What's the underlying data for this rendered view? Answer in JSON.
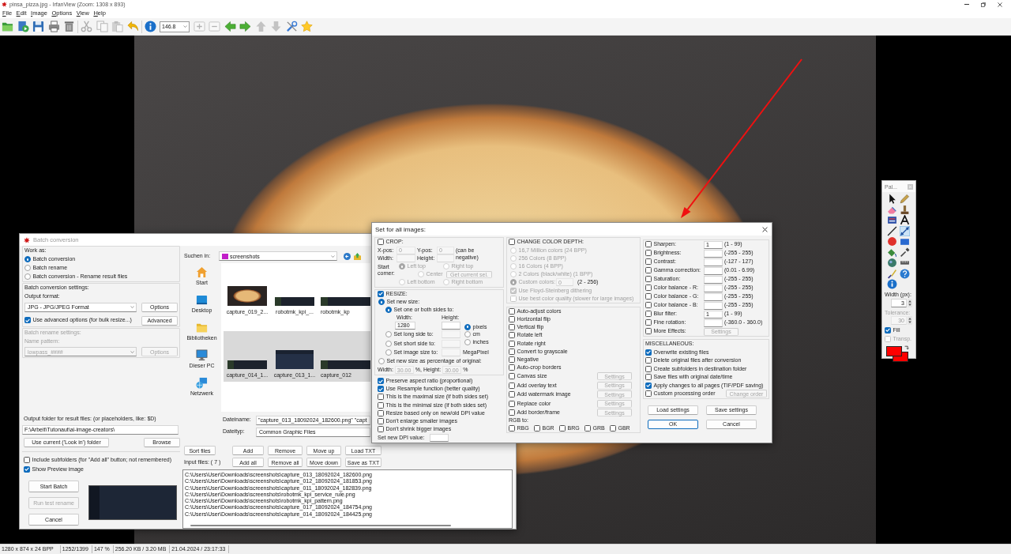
{
  "window": {
    "title": "pinsa_pizza.jpg - IrfanView (Zoom: 1308 x 893)"
  },
  "menu": [
    "File",
    "Edit",
    "Image",
    "Options",
    "View",
    "Help"
  ],
  "toolbar": {
    "groups": [
      [
        {
          "kind": "open",
          "disabled": false
        },
        {
          "kind": "slideshow",
          "disabled": false
        },
        {
          "kind": "save",
          "disabled": false
        },
        {
          "kind": "print",
          "disabled": false
        },
        {
          "kind": "delete",
          "disabled": false
        }
      ],
      [
        {
          "kind": "cut",
          "disabled": true
        },
        {
          "kind": "copy",
          "disabled": true
        },
        {
          "kind": "paste",
          "disabled": true
        },
        {
          "kind": "undo",
          "disabled": false
        }
      ],
      [
        {
          "kind": "info",
          "disabled": false
        },
        {
          "kind": "zoom",
          "value": "146.8"
        },
        {
          "kind": "zoom_in",
          "disabled": true
        },
        {
          "kind": "zoom_out",
          "disabled": true
        },
        {
          "kind": "previous",
          "disabled": false
        },
        {
          "kind": "next",
          "disabled": false
        },
        {
          "kind": "up",
          "disabled": true
        },
        {
          "kind": "down",
          "disabled": true
        },
        {
          "kind": "tools",
          "disabled": false
        },
        {
          "kind": "favorite",
          "disabled": false
        }
      ]
    ]
  },
  "status_bar": [
    "1280 x 874 x 24 BPP",
    "1252/1399",
    "147 %",
    "256.20 KB / 3.20 MB",
    "21.04.2024 / 23:17:33"
  ],
  "paint": {
    "title": "Pal...",
    "tools": [
      {
        "kind": "select",
        "selected": false
      },
      {
        "kind": "pencil",
        "selected": false
      },
      {
        "kind": "eraser",
        "selected": false
      },
      {
        "kind": "stamp",
        "selected": false
      },
      {
        "kind": "speech",
        "selected": false
      },
      {
        "kind": "text",
        "selected": false
      },
      {
        "kind": "line",
        "selected": false
      },
      {
        "kind": "arrow",
        "selected": true
      },
      {
        "kind": "ellipse",
        "selected": false
      },
      {
        "kind": "rectangle",
        "selected": false
      },
      {
        "kind": "fill",
        "selected": false
      },
      {
        "kind": "picker",
        "selected": false
      },
      {
        "kind": "spray",
        "selected": false
      },
      {
        "kind": "measure",
        "selected": false
      },
      {
        "kind": "brush",
        "selected": false
      },
      {
        "kind": "help",
        "selected": false
      },
      {
        "kind": "info",
        "selected": false
      }
    ],
    "width_label": "Width (px):",
    "width_value": "3",
    "tolerance_label": "Tolerance:",
    "tolerance_value": "30",
    "tolerance_disabled": true,
    "fill": {
      "label": "Fill",
      "checked": true
    },
    "transparent": {
      "label": "Transp.",
      "checked": false,
      "disabled": true
    },
    "swatches": [
      {
        "color": "#ff0000"
      },
      {
        "color": "#ff0000"
      }
    ]
  },
  "batch": {
    "title": "Batch conversion",
    "active": false,
    "work_as": {
      "label": "Work as:",
      "options": [
        {
          "label": "Batch conversion",
          "selected": true
        },
        {
          "label": "Batch rename",
          "selected": false
        },
        {
          "label": "Batch conversion - Rename result files",
          "selected": false
        }
      ]
    },
    "conversion_settings": {
      "label": "Batch conversion settings:",
      "format_label": "Output format:",
      "format_value": "JPG - JPG/JPEG Format",
      "options_button": "Options",
      "advanced": {
        "label": "Use advanced options (for bulk resize...)",
        "checked": true
      },
      "advanced_button": "Advanced"
    },
    "rename_settings": {
      "label": "Batch rename settings:",
      "pattern_label": "Name pattern:",
      "pattern_value": "lowpass_####",
      "options_button": "Options",
      "disabled": true
    },
    "output": {
      "label": "Output folder for result files: (or placeholders, like: $D)",
      "value": "F:\\Arbeit\\Tutonaut\\ai-image-creators\\",
      "use_current_button": "Use current ('Look in') folder",
      "browse_button": "Browse"
    },
    "include_subfolders": {
      "label": "Include subfolders (for \"Add all\" button; not remembered)",
      "checked": false
    },
    "show_preview": {
      "label": "Show Preview image",
      "checked": true
    },
    "start_button": "Start Batch",
    "test_button": {
      "label": "Run test rename",
      "disabled": true
    },
    "cancel_button": "Cancel",
    "browser": {
      "look_in_label": "Suchen in:",
      "look_in_value": "screenshots",
      "places": [
        {
          "label": "Start",
          "kind": "home"
        },
        {
          "label": "Desktop",
          "kind": "desktop"
        },
        {
          "label": "Bibliotheken",
          "kind": "libraries"
        },
        {
          "label": "Dieser PC",
          "kind": "computer"
        },
        {
          "label": "Netzwerk",
          "kind": "network"
        }
      ],
      "files": [
        {
          "name": "capture_019_2...",
          "kind": "photo",
          "selected": false
        },
        {
          "name": "robotmk_kpi_...",
          "kind": "banner",
          "selected": false
        },
        {
          "name": "robotmk_kp",
          "kind": "banner",
          "selected": false
        },
        {
          "name": "capture_014_1...",
          "kind": "banner",
          "selected": true
        },
        {
          "name": "capture_013_1...",
          "kind": "screenshot",
          "selected": true
        },
        {
          "name": "capture_012",
          "kind": "banner",
          "selected": true
        }
      ],
      "filename_label": "Dateiname:",
      "filename_value": "\"capture_013_18092024_182600.png\" \"capt",
      "filetype_label": "Dateityp:",
      "filetype_value": "Common Graphic Files"
    },
    "buttons_top": [
      "Sort files",
      "Add",
      "Remove",
      "Move up",
      "Load TXT"
    ],
    "input_label": "Input files: ( 7 )",
    "buttons_bottom": [
      "Add all",
      "Remove all",
      "Move down",
      "Save as TXT"
    ],
    "input_files": [
      "C:\\Users\\User\\Downloads\\screenshots\\capture_013_18092024_182600.png",
      "C:\\Users\\User\\Downloads\\screenshots\\capture_012_18092024_181853.png",
      "C:\\Users\\User\\Downloads\\screenshots\\capture_011_18092024_182839.png",
      "C:\\Users\\User\\Downloads\\screenshots\\robotmk_kpi_service_rule.png",
      "C:\\Users\\User\\Downloads\\screenshots\\robotmk_kpi_pattern.png",
      "C:\\Users\\User\\Downloads\\screenshots\\capture_017_18092024_184754.png",
      "C:\\Users\\User\\Downloads\\screenshots\\capture_014_18092024_184425.png"
    ]
  },
  "settings": {
    "title": "Set for all images:",
    "crop": {
      "label": "CROP:",
      "checked": false,
      "xpos_label": "X-pos:",
      "xpos_value": "0",
      "ypos_label": "Y-pos:",
      "ypos_value": "0",
      "note": "(can be negative)",
      "width_label": "Width:",
      "height_label": "Height:",
      "corner_label": "Start corner:",
      "corners": [
        {
          "label": "Left top",
          "selected": true
        },
        {
          "label": "Right top",
          "selected": false
        },
        {
          "label": "Center",
          "selected": false
        },
        {
          "label": "Left bottom",
          "selected": false
        },
        {
          "label": "Right bottom",
          "selected": false
        }
      ],
      "get_button": "Get current sel."
    },
    "resize": {
      "label": "RESIZE:",
      "checked": true,
      "new_size": {
        "label": "Set new size:",
        "selected": true
      },
      "sides": {
        "label": "Set one or both sides to:",
        "selected": true
      },
      "width_label": "Width:",
      "width_value": "1280",
      "height_label": "Height:",
      "units": [
        {
          "label": "pixels",
          "selected": true
        },
        {
          "label": "cm",
          "selected": false
        },
        {
          "label": "inches",
          "selected": false
        }
      ],
      "long": {
        "label": "Set long side to:",
        "selected": false
      },
      "short": {
        "label": "Set short side to:",
        "selected": false
      },
      "image_size": {
        "label": "Set image size to:",
        "selected": false
      },
      "megapixel": "MegaPixel",
      "percentage": {
        "label": "Set new size as percentage of original:",
        "selected": false
      },
      "pct_width_label": "Width:",
      "pct_width_value": "30.00",
      "pct_height_label": "%, Height:",
      "pct_height_value": "30.00",
      "pct_unit": "%"
    },
    "resize_options": [
      {
        "label": "Preserve aspect ratio (proportional)",
        "checked": true
      },
      {
        "label": "Use Resample function (better quality)",
        "checked": true
      },
      {
        "label": "This is the maximal size (if both sides set)",
        "checked": false
      },
      {
        "label": "This is the minimal size (if both sides set)",
        "checked": false
      },
      {
        "label": "Resize based only on new/old DPI value",
        "checked": false
      },
      {
        "label": "Don't enlarge smaller images",
        "checked": false
      },
      {
        "label": "Don't shrink bigger images",
        "checked": false
      }
    ],
    "dpi_label": "Set new DPI value:",
    "color_depth": {
      "label": "CHANGE COLOR DEPTH:",
      "checked": false,
      "options": [
        {
          "label": "16,7 Million colors (24 BPP)",
          "selected": false
        },
        {
          "label": "256 Colors (8 BPP)",
          "selected": false
        },
        {
          "label": "16 Colors (4 BPP)",
          "selected": false
        },
        {
          "label": "2 Colors (black/white) (1 BPP)",
          "selected": false
        },
        {
          "label": "Custom colors:",
          "selected": true
        }
      ],
      "custom_value": "0",
      "custom_range": "(2 - 256)",
      "dither": {
        "label": "Use Floyd-Steinberg dithering",
        "checked": true
      },
      "best_quality": {
        "label": "Use best color quality (slower for large images)",
        "checked": false
      }
    },
    "effects": [
      {
        "kind": "check",
        "label": "Auto-adjust colors",
        "checked": false
      },
      {
        "kind": "check",
        "label": "Horizontal flip",
        "checked": false
      },
      {
        "kind": "check",
        "label": "Vertical flip",
        "checked": false
      },
      {
        "kind": "check",
        "label": "Rotate left",
        "checked": false
      },
      {
        "kind": "check",
        "label": "Rotate right",
        "checked": false
      },
      {
        "kind": "check",
        "label": "Convert to grayscale",
        "checked": false
      },
      {
        "kind": "check",
        "label": "Negative",
        "checked": false
      },
      {
        "kind": "check",
        "label": "Auto-crop borders",
        "checked": false
      },
      {
        "kind": "settings",
        "label": "Canvas size",
        "checked": false,
        "button": {
          "label": "Settings",
          "disabled": true
        }
      },
      {
        "kind": "settings",
        "label": "Add overlay text",
        "checked": false,
        "button": {
          "label": "Settings",
          "disabled": true
        }
      },
      {
        "kind": "settings",
        "label": "Add watermark image",
        "checked": false,
        "button": {
          "label": "Settings",
          "disabled": true
        }
      },
      {
        "kind": "settings",
        "label": "Replace color",
        "checked": false,
        "button": {
          "label": "Settings",
          "disabled": true
        }
      },
      {
        "kind": "settings",
        "label": "Add border/frame",
        "checked": false,
        "button": {
          "label": "Settings",
          "disabled": true
        }
      }
    ],
    "rgb": {
      "label": "RGB to:",
      "options": [
        {
          "label": "RBG",
          "checked": false
        },
        {
          "label": "BGR",
          "checked": false
        },
        {
          "label": "BRG",
          "checked": false
        },
        {
          "label": "GRB",
          "checked": false
        },
        {
          "label": "GBR",
          "checked": false
        }
      ]
    },
    "adjustments": [
      {
        "label": "Sharpen:",
        "checked": false,
        "value": "1",
        "range": "(1 - 99)"
      },
      {
        "label": "Brightness:",
        "checked": false,
        "range": "(-255 - 255)"
      },
      {
        "label": "Contrast:",
        "checked": false,
        "range": "(-127 - 127)"
      },
      {
        "label": "Gamma correction:",
        "checked": false,
        "range": "(0.01 - 6.99)"
      },
      {
        "label": "Saturation:",
        "checked": false,
        "range": "(-255 - 255)"
      },
      {
        "label": "Color balance - R:",
        "checked": false,
        "range": "(-255 - 255)"
      },
      {
        "label": "Color balance - G:",
        "checked": false,
        "range": "(-255 - 255)"
      },
      {
        "label": "Color balance - B:",
        "checked": false,
        "range": "(-255 - 255)"
      },
      {
        "label": "Blur filter:",
        "checked": false,
        "value": "1",
        "range": "(1 - 99)"
      },
      {
        "label": "Fine rotation:",
        "checked": false,
        "range": "(-360.0 - 360.0)"
      }
    ],
    "more_effects": {
      "label": "More Effects:",
      "checked": false,
      "button": {
        "label": "Settings",
        "disabled": true
      }
    },
    "misc": {
      "label": "MISCELLANEOUS:",
      "options": [
        {
          "label": "Overwrite existing files",
          "checked": true
        },
        {
          "label": "Delete original files after conversion",
          "checked": false
        },
        {
          "label": "Create subfolders in destination folder",
          "checked": false
        },
        {
          "label": "Save files with original date/time",
          "checked": false
        },
        {
          "label": "Apply changes to all pages (TIF/PDF saving)",
          "checked": true
        },
        {
          "label": "Custom processing order",
          "checked": false
        }
      ],
      "order_button": {
        "label": "Change order",
        "disabled": true
      }
    },
    "load_button": "Load settings",
    "save_button": "Save settings",
    "ok_button": {
      "label": "OK",
      "default": true
    },
    "cancel_button": "Cancel"
  }
}
